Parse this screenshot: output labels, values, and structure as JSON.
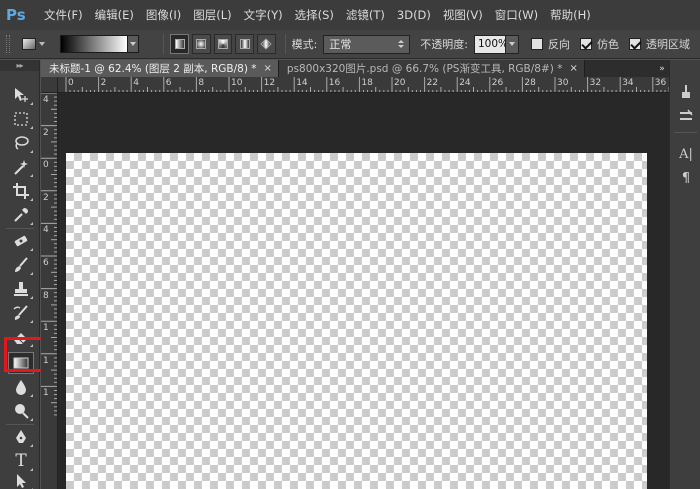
{
  "app": {
    "logo": "Ps"
  },
  "menu": [
    "文件(F)",
    "编辑(E)",
    "图像(I)",
    "图层(L)",
    "文字(Y)",
    "选择(S)",
    "滤镜(T)",
    "3D(D)",
    "视图(V)",
    "窗口(W)",
    "帮助(H)"
  ],
  "options": {
    "mode_label": "模式:",
    "mode_value": "正常",
    "opacity_label": "不透明度:",
    "opacity_value": "100%",
    "reverse_label": "反向",
    "reverse_checked": false,
    "dither_label": "仿色",
    "dither_checked": true,
    "transparency_label": "透明区域",
    "transparency_checked": true
  },
  "tabs": [
    {
      "title": "未标题-1 @ 62.4% (图层 2 副本, RGB/8) *",
      "active": true,
      "close": "×"
    },
    {
      "title": "ps800x320图片.psd @ 66.7% (PS渐变工具, RGB/8#) *",
      "active": false,
      "close": "×"
    }
  ],
  "tabs_overflow": "»",
  "toolbar_header": "▸▸",
  "ruler_h": [
    "0",
    "2",
    "4",
    "6",
    "8",
    "10",
    "12",
    "14",
    "16",
    "18",
    "20",
    "22",
    "24",
    "26",
    "28",
    "30",
    "32",
    "34",
    "36"
  ],
  "ruler_v": [
    "4",
    "2",
    "0",
    "2",
    "4",
    "6",
    "8",
    "1",
    "1",
    "1"
  ],
  "tools": [
    "move-tool",
    "marquee-tool",
    "lasso-tool",
    "magic-wand-tool",
    "crop-tool",
    "eyedropper-tool",
    "healing-brush-tool",
    "brush-tool",
    "clone-stamp-tool",
    "history-brush-tool",
    "eraser-tool",
    "gradient-tool",
    "blur-tool",
    "dodge-tool",
    "pen-tool",
    "type-tool",
    "path-selection-tool"
  ],
  "selected_tool": "gradient-tool",
  "type_tool_glyph": "T",
  "right_panel": {
    "char_glyph": "A|",
    "para_glyph": "¶"
  }
}
